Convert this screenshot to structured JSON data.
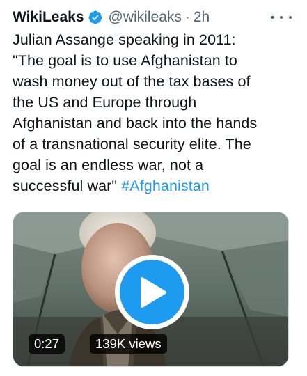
{
  "tweet": {
    "display_name": "WikiLeaks",
    "handle": "@wikileaks",
    "separator": "·",
    "time": "2h",
    "text_lines": [
      "Julian Assange speaking in 2011:",
      "\"The goal is to use Afghanistan to",
      "wash money out of the tax bases of",
      "the US and Europe through",
      "Afghanistan and back into the hands",
      "of a transnational security elite. The",
      "goal is an endless war, not a",
      "successful war\""
    ],
    "hashtag": "#Afghanistan",
    "video": {
      "duration": "0:27",
      "views": "139K views"
    }
  },
  "colors": {
    "verified": "#1d9bf0",
    "hashtag": "#1d9bf0",
    "play_button": "#1d9bf0",
    "text": "#0f1419",
    "secondary_text": "#536471"
  },
  "icons": [
    "verified-badge-icon",
    "more-options-icon",
    "play-icon"
  ]
}
